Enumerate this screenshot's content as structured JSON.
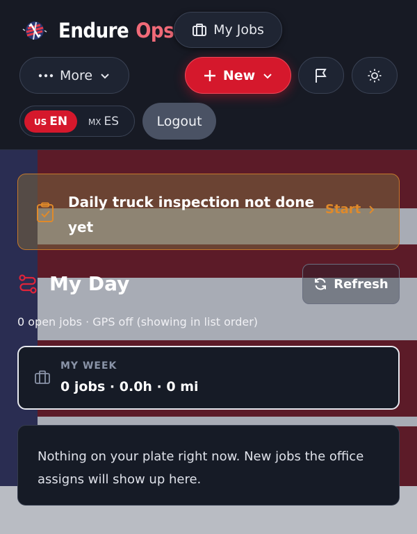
{
  "brand": {
    "word1": "Endure",
    "word2": "Ops"
  },
  "header": {
    "my_jobs_label": "My Jobs",
    "more_label": "More",
    "new_label": "New",
    "logout_label": "Logout",
    "language": {
      "selected": "EN",
      "options": [
        {
          "flag": "US",
          "code": "EN"
        },
        {
          "flag": "MX",
          "code": "ES"
        }
      ]
    },
    "icons": [
      "briefcase-icon",
      "ellipsis-icon",
      "chevron-down-icon",
      "plus-icon",
      "flag-icon",
      "sun-icon"
    ]
  },
  "alert": {
    "message": "Daily truck inspection not done yet",
    "action_label": "Start",
    "icon": "clipboard-check-icon"
  },
  "my_day": {
    "title": "My Day",
    "refresh_label": "Refresh",
    "subtitle": "0 open jobs · GPS off (showing in list order)",
    "icon": "route-icon"
  },
  "week": {
    "label": "MY WEEK",
    "summary": "0 jobs · 0.0h · 0 mi",
    "icon": "briefcase-icon"
  },
  "empty_state": {
    "message": "Nothing on your plate right now. New jobs the office assigns will show up here."
  },
  "colors": {
    "header_bg": "#171a24",
    "accent_red": "#d5182c",
    "brand_ops": "#f06a78",
    "warning": "#e08a2a",
    "card_bg": "#161b26"
  }
}
